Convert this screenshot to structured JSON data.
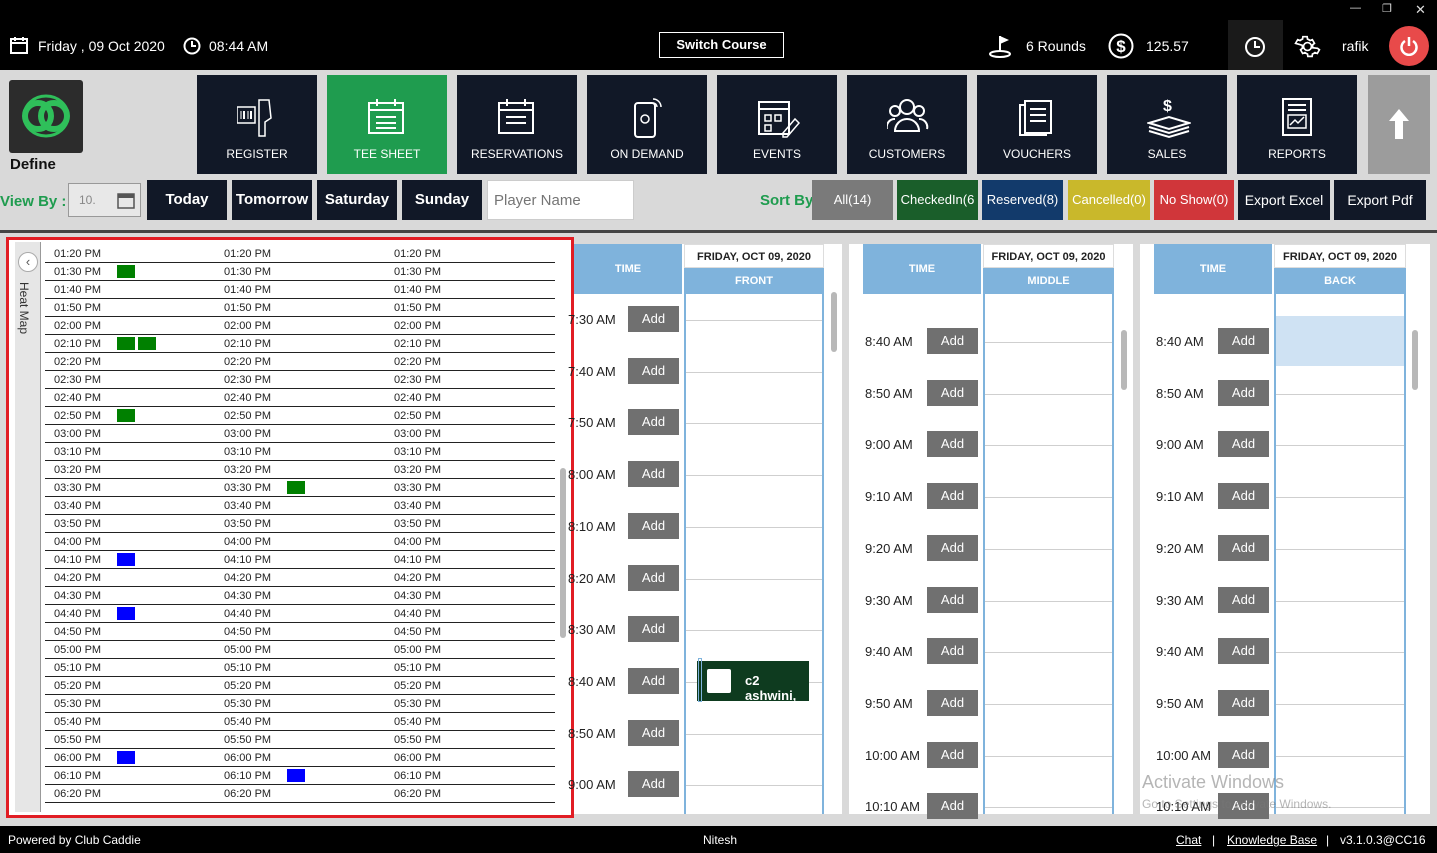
{
  "header": {
    "date": "Friday ,  09 Oct 2020",
    "time": "08:44 AM",
    "switch_course": "Switch Course",
    "rounds": "6 Rounds",
    "amount": "125.57",
    "user": "rafik"
  },
  "logo_label": "Define",
  "nav": [
    {
      "label": "REGISTER"
    },
    {
      "label": "TEE SHEET"
    },
    {
      "label": "RESERVATIONS"
    },
    {
      "label": "ON DEMAND"
    },
    {
      "label": "EVENTS"
    },
    {
      "label": "CUSTOMERS"
    },
    {
      "label": "VOUCHERS"
    },
    {
      "label": "SALES"
    },
    {
      "label": "REPORTS"
    }
  ],
  "filters": {
    "view_by": "View By :",
    "date_value": "10.",
    "today": "Today",
    "tomorrow": "Tomorrow",
    "saturday": "Saturday",
    "sunday": "Sunday",
    "player_placeholder": "Player Name",
    "sort_by": "Sort By",
    "all": "All(14)",
    "checkedin": "CheckedIn(6",
    "reserved": "Reserved(8)",
    "cancelled": "Cancelled(0)",
    "noshow": "No Show(0)",
    "export_excel": "Export Excel",
    "export_pdf": "Export Pdf"
  },
  "heatmap": {
    "tab_label": "Heat Map",
    "times": [
      "01:20 PM",
      "01:30 PM",
      "01:40 PM",
      "01:50 PM",
      "02:00 PM",
      "02:10 PM",
      "02:20 PM",
      "02:30 PM",
      "02:40 PM",
      "02:50 PM",
      "03:00 PM",
      "03:10 PM",
      "03:20 PM",
      "03:30 PM",
      "03:40 PM",
      "03:50 PM",
      "04:00 PM",
      "04:10 PM",
      "04:20 PM",
      "04:30 PM",
      "04:40 PM",
      "04:50 PM",
      "05:00 PM",
      "05:10 PM",
      "05:20 PM",
      "05:30 PM",
      "05:40 PM",
      "05:50 PM",
      "06:00 PM",
      "06:10 PM",
      "06:20 PM"
    ],
    "colors": {
      "checked": "#008000",
      "reserved": "#0000ff"
    }
  },
  "sheets": {
    "time_label": "TIME",
    "add_label": "Add",
    "front": {
      "day": "FRIDAY, OCT 09, 2020",
      "course": "FRONT",
      "times": [
        "7:30 AM",
        "7:40 AM",
        "7:50 AM",
        "8:00 AM",
        "8:10 AM",
        "8:20 AM",
        "8:30 AM",
        "8:40 AM",
        "8:50 AM",
        "9:00 AM"
      ],
      "booking": "c2 ashwini,"
    },
    "middle": {
      "day": "FRIDAY, OCT 09, 2020",
      "course": "MIDDLE",
      "times": [
        "8:40 AM",
        "8:50 AM",
        "9:00 AM",
        "9:10 AM",
        "9:20 AM",
        "9:30 AM",
        "9:40 AM",
        "9:50 AM",
        "10:00 AM",
        "10:10 AM"
      ]
    },
    "back": {
      "day": "FRIDAY, OCT 09, 2020",
      "course": "BACK",
      "times": [
        "8:40 AM",
        "8:50 AM",
        "9:00 AM",
        "9:10 AM",
        "9:20 AM",
        "9:30 AM",
        "9:40 AM",
        "9:50 AM",
        "10:00 AM",
        "10:10 AM"
      ]
    }
  },
  "watermark": {
    "line1": "Activate Windows",
    "line2": "Go to Settings to activate Windows."
  },
  "footer": {
    "powered": "Powered by Club Caddie",
    "user": "Nitesh",
    "chat": "Chat",
    "kb": "Knowledge Base",
    "version": "v3.1.0.3@CC16"
  }
}
